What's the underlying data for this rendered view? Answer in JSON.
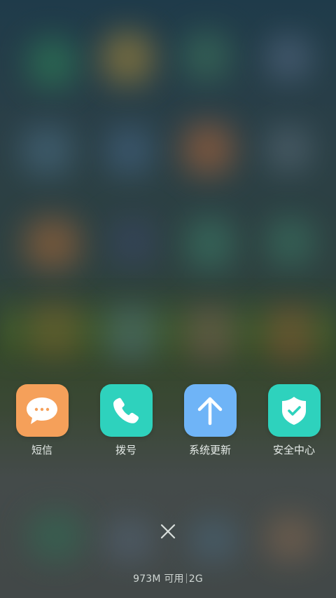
{
  "colors": {
    "sms": "#F5A05A",
    "dialer": "#2ED2BD",
    "updater": "#6FB4F7",
    "security": "#2ED2BD"
  },
  "recent_apps": [
    {
      "label": "短信",
      "icon": "chat-bubble-icon"
    },
    {
      "label": "拨号",
      "icon": "phone-icon"
    },
    {
      "label": "系统更新",
      "icon": "arrow-up-icon"
    },
    {
      "label": "安全中心",
      "icon": "shield-check-icon"
    }
  ],
  "close_icon": "close-icon",
  "memory": {
    "available": "973M 可用",
    "total": "2G"
  }
}
